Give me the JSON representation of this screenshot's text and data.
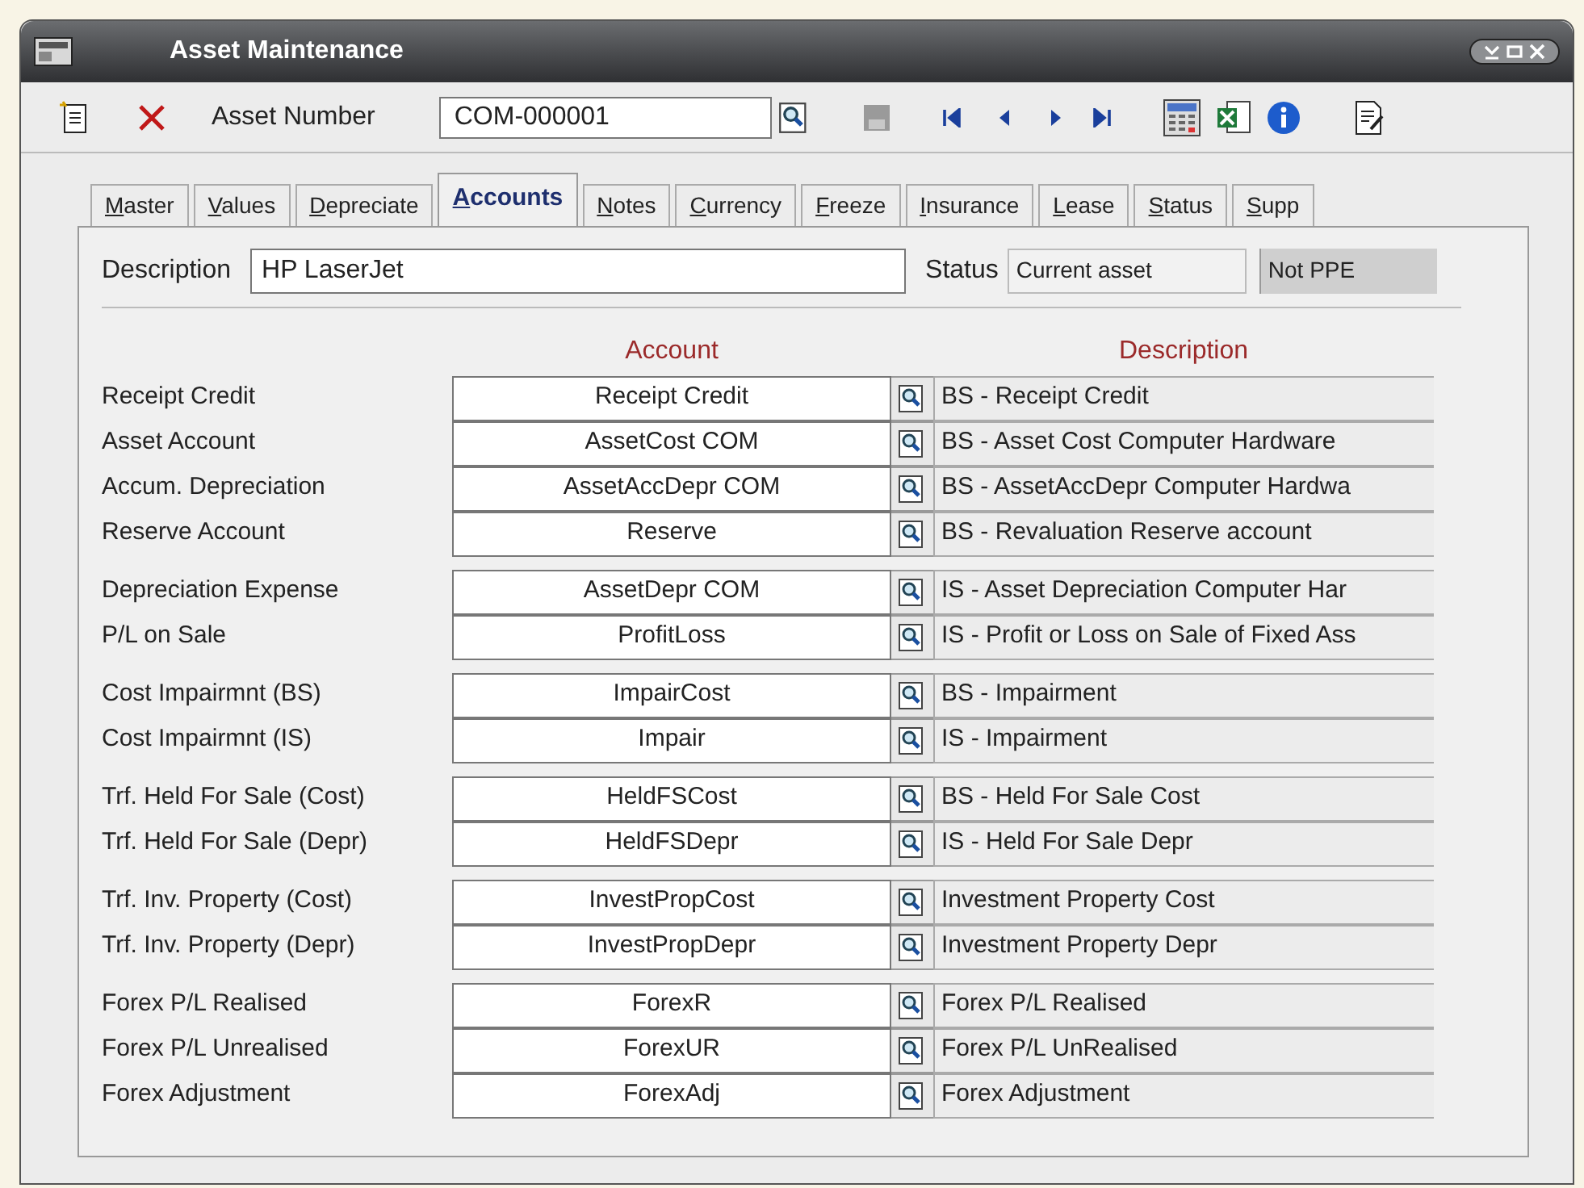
{
  "window": {
    "title": "Asset Maintenance"
  },
  "toolbar": {
    "asset_number_label": "Asset Number",
    "asset_number_value": "COM-000001"
  },
  "tabs": [
    {
      "label": "Master",
      "selected": false
    },
    {
      "label": "Values",
      "selected": false
    },
    {
      "label": "Depreciate",
      "selected": false
    },
    {
      "label": "Accounts",
      "selected": true
    },
    {
      "label": "Notes",
      "selected": false
    },
    {
      "label": "Currency",
      "selected": false
    },
    {
      "label": "Freeze",
      "selected": false
    },
    {
      "label": "Insurance",
      "selected": false
    },
    {
      "label": "Lease",
      "selected": false
    },
    {
      "label": "Status",
      "selected": false
    },
    {
      "label": "Supp",
      "selected": false
    }
  ],
  "description": {
    "label": "Description",
    "value": "HP LaserJet"
  },
  "status": {
    "label": "Status",
    "value": "Current asset",
    "ppe": "Not PPE"
  },
  "columns": {
    "account": "Account",
    "description": "Description"
  },
  "groups": [
    [
      {
        "label": "Receipt Credit",
        "account": "Receipt Credit",
        "description": "BS - Receipt Credit"
      },
      {
        "label": "Asset Account",
        "account": "AssetCost COM",
        "description": "BS - Asset Cost Computer Hardware"
      },
      {
        "label": "Accum. Depreciation",
        "account": "AssetAccDepr COM",
        "description": "BS - AssetAccDepr Computer Hardwa"
      },
      {
        "label": "Reserve Account",
        "account": "Reserve",
        "description": "BS - Revaluation Reserve account"
      }
    ],
    [
      {
        "label": "Depreciation Expense",
        "account": "AssetDepr COM",
        "description": "IS - Asset Depreciation Computer Har"
      },
      {
        "label": "P/L on Sale",
        "account": "ProfitLoss",
        "description": "IS - Profit or Loss on Sale of Fixed Ass"
      }
    ],
    [
      {
        "label": "Cost Impairmnt (BS)",
        "account": "ImpairCost",
        "description": "BS - Impairment"
      },
      {
        "label": "Cost Impairmnt (IS)",
        "account": "Impair",
        "description": "IS - Impairment"
      }
    ],
    [
      {
        "label": "Trf. Held For Sale (Cost)",
        "account": "HeldFSCost",
        "description": "BS - Held For Sale Cost"
      },
      {
        "label": "Trf. Held For Sale (Depr)",
        "account": "HeldFSDepr",
        "description": "IS - Held For Sale Depr"
      }
    ],
    [
      {
        "label": "Trf. Inv. Property (Cost)",
        "account": "InvestPropCost",
        "description": "Investment  Property Cost"
      },
      {
        "label": "Trf. Inv. Property (Depr)",
        "account": "InvestPropDepr",
        "description": "Investment Property Depr"
      }
    ],
    [
      {
        "label": "Forex P/L Realised",
        "account": "ForexR",
        "description": "Forex P/L Realised"
      },
      {
        "label": "Forex P/L Unrealised",
        "account": "ForexUR",
        "description": "Forex P/L UnRealised"
      },
      {
        "label": "Forex Adjustment",
        "account": "ForexAdj",
        "description": "Forex Adjustment"
      }
    ]
  ]
}
